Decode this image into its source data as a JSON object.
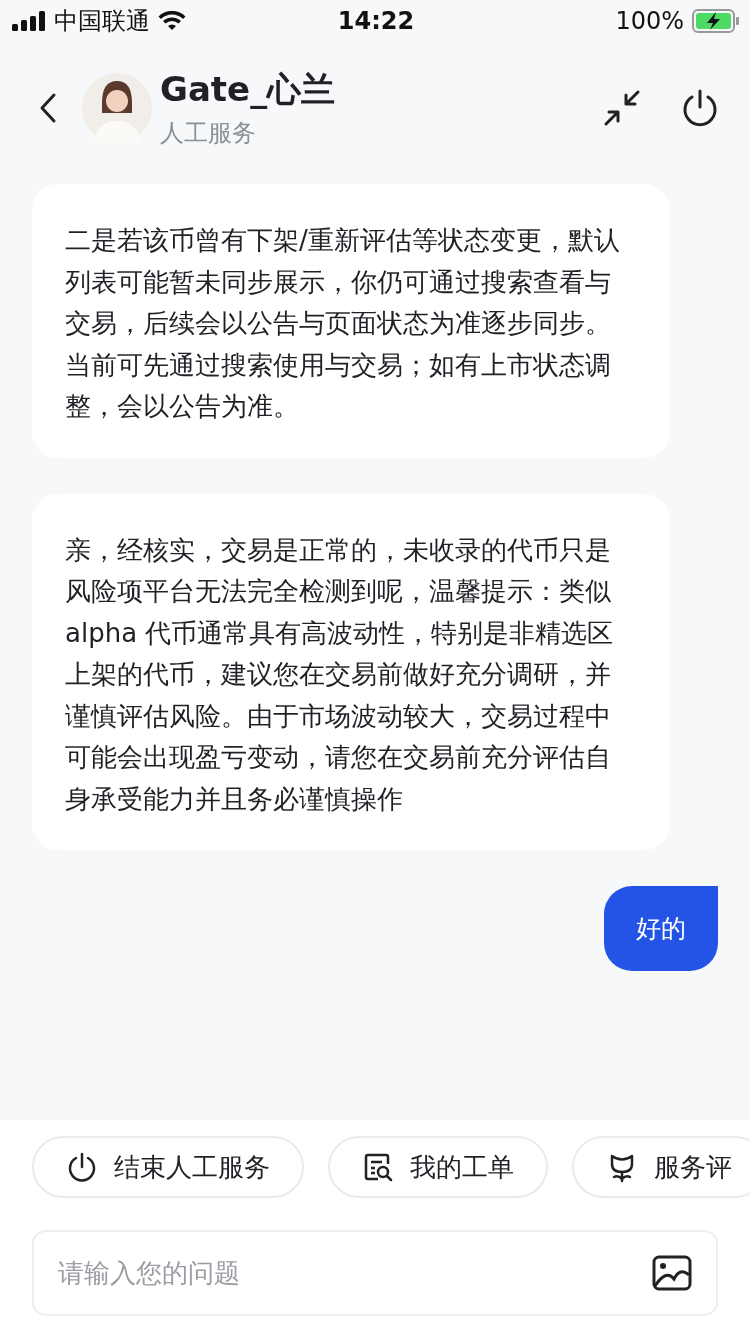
{
  "status_bar": {
    "carrier": "中国联通",
    "time": "14:22",
    "battery": "100%"
  },
  "header": {
    "name": "Gate_心兰",
    "subtitle": "人工服务"
  },
  "messages": [
    {
      "kind": "agent",
      "paragraphs": [
        "二是若该币曾有下架/重新评估等状态变更，默认列表可能暂未同步展示，你仍可通过搜索查看与交易，后续会以公告与页面状态为准逐步同步。",
        "当前可先通过搜索使用与交易；如有上市状态调整，会以公告为准。"
      ]
    },
    {
      "kind": "agent",
      "paragraphs": [
        "亲，经核实，交易是正常的，未收录的代币只是风险项平台无法完全检测到呢，温馨提示：类似 alpha 代币通常具有高波动性，特别是非精选区上架的代币，建议您在交易前做好充分调研，并谨慎评估风险。由于市场波动较大，交易过程中可能会出现盈亏变动，请您在交易前充分评估自身承受能力并且务必谨慎操作"
      ]
    },
    {
      "kind": "user",
      "paragraphs": [
        "好的"
      ]
    }
  ],
  "quick_actions": [
    {
      "kind": "power",
      "label": "结束人工服务"
    },
    {
      "kind": "ticket",
      "label": "我的工单"
    },
    {
      "kind": "rating",
      "label": "服务评"
    }
  ],
  "input": {
    "placeholder": "请输入您的问题"
  }
}
